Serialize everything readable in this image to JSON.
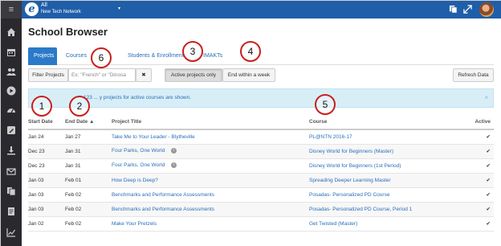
{
  "topbar": {
    "logo_letter": "e",
    "network_scope": "All",
    "network_name": "New Tech Network",
    "caret": "▾",
    "icons": [
      "copy-icon",
      "expand-icon",
      "avatar"
    ]
  },
  "sidebar": {
    "menu_glyph": "≡",
    "icons": [
      "home-icon",
      "calendar-icon",
      "people-icon",
      "play-icon",
      "gauge-icon",
      "edit-icon",
      "download-icon",
      "mail-icon",
      "files-icon",
      "document-icon",
      "chart-icon"
    ]
  },
  "page": {
    "title": "School Browser"
  },
  "tabs": [
    {
      "label": "Projects",
      "active": true
    },
    {
      "label": "Courses",
      "active": false
    },
    {
      "label": "Students & Enrollment",
      "active": false
    },
    {
      "label": "IMAKTs",
      "active": false
    }
  ],
  "filters": {
    "filter_label": "Filter Projects",
    "search_placeholder": "Ex: \"French\" or \"Dinosa",
    "clear_glyph": "✖",
    "active_only_label": "Active projects only",
    "end_week_label": "End within a week",
    "refresh_label": "Refresh Data"
  },
  "alert": {
    "text": "123 ... y projects for active courses are shown.",
    "close": "×"
  },
  "table": {
    "headers": {
      "start": "Start Date",
      "end": "End Date ▲",
      "title": "Project Title",
      "course": "Course",
      "active": "Active"
    },
    "rows": [
      {
        "start": "Jan 24",
        "end": "Jan 27",
        "title": "Take Me to Your Leader - Blytheville",
        "info": false,
        "course": "PL@NTN 2016-17",
        "active": "✔"
      },
      {
        "start": "Dec 23",
        "end": "Jan 31",
        "title": "Four Parks, One World",
        "info": true,
        "course": "Disney World for Beginners (Master)",
        "active": "✔"
      },
      {
        "start": "Dec 23",
        "end": "Jan 31",
        "title": "Four Parks, One World",
        "info": true,
        "course": "Disney World for Beginners (1st Period)",
        "active": "✔"
      },
      {
        "start": "Jan 03",
        "end": "Feb 01",
        "title": "How Deep is Deep?",
        "info": false,
        "course": "Spreading Deeper Learning Master",
        "active": "✔"
      },
      {
        "start": "Jan 03",
        "end": "Feb 02",
        "title": "Benchmarks and Performance Assessments",
        "info": false,
        "course": "Posadas- Personalized PD Course",
        "active": "✔"
      },
      {
        "start": "Jan 03",
        "end": "Feb 02",
        "title": "Benchmarks and Performance Assessments",
        "info": false,
        "course": "Posadas- Personalized PD Course, Period 1",
        "active": "✔"
      },
      {
        "start": "Jan 02",
        "end": "Feb 02",
        "title": "Make Your Pretzels",
        "info": false,
        "course": "Get Twisted (Master)",
        "active": "✔"
      }
    ]
  },
  "callouts": [
    "1",
    "2",
    "3",
    "4",
    "5",
    "6"
  ],
  "colors": {
    "topbar": "#1f5ea8",
    "sidebar": "#2a2a2e",
    "link": "#2a6eb8",
    "callout_ring": "#c8201e",
    "alert_bg": "#d8eef7"
  }
}
